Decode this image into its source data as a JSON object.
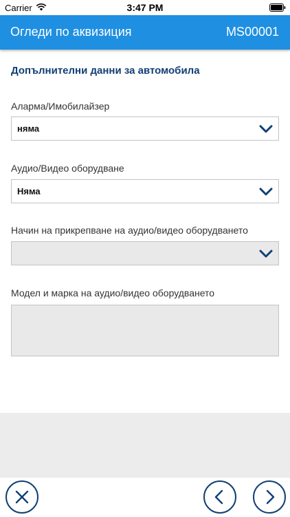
{
  "status_bar": {
    "carrier": "Carrier",
    "time": "3:47 PM",
    "wifi_icon": "wifi-icon",
    "battery_icon": "battery-icon"
  },
  "header": {
    "title": "Огледи по аквизиция",
    "reference": "MS00001",
    "background_color": "#1f8fe1"
  },
  "section": {
    "title": "Допълнителни данни за автомобила"
  },
  "fields": {
    "alarm": {
      "label": "Аларма/Имобилайзер",
      "value": "няма"
    },
    "audio_video": {
      "label": "Аудио/Видео оборудване",
      "value": "Няма"
    },
    "mounting": {
      "label": "Начин на прикрепване на аудио/видео оборудването",
      "value": ""
    },
    "model_brand": {
      "label": "Модел и марка на аудио/видео оборудването",
      "value": ""
    }
  },
  "footer": {
    "close_icon": "close-icon",
    "prev_icon": "chevron-left-icon",
    "next_icon": "chevron-right-icon",
    "accent_color": "#123f74"
  }
}
